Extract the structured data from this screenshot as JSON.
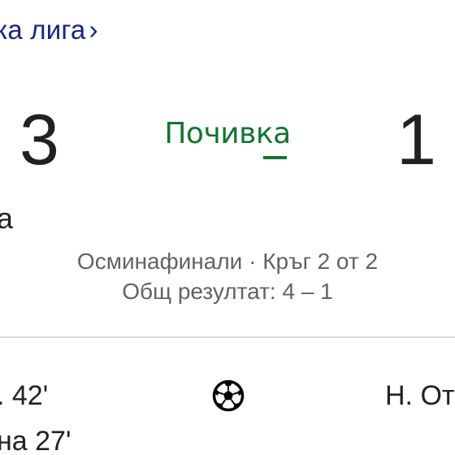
{
  "header": {
    "league_link_text": "ка лига",
    "chevron": "›"
  },
  "match": {
    "home_score": "3",
    "away_score": "1",
    "status": "Почивка",
    "home_team_fragment": "а",
    "stage": "Осминафинали · Кръг 2 от 2",
    "aggregate": "Общ резултат: 4 – 1"
  },
  "events": {
    "home_1": ". 42'",
    "home_2": "на 27'",
    "away_1": "Н. От",
    "icon": "soccer-ball-icon"
  },
  "colors": {
    "status_green": "#137333",
    "link_navy": "#1a237e",
    "secondary_text": "#5f6368",
    "divider": "#dadce0"
  }
}
